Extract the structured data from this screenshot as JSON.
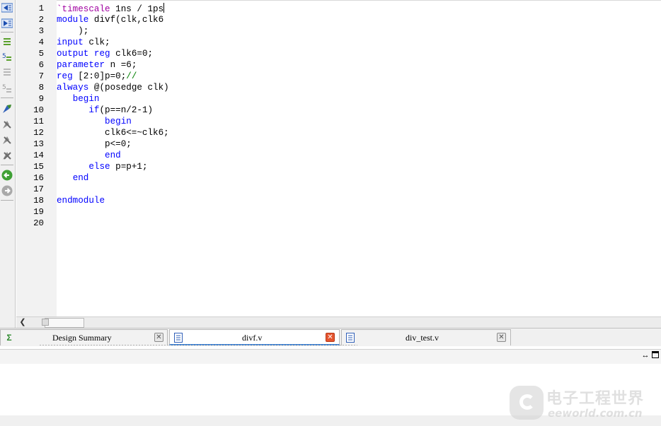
{
  "editor": {
    "line_numbers": [
      "1",
      "2",
      "3",
      "4",
      "5",
      "6",
      "7",
      "8",
      "9",
      "10",
      "11",
      "12",
      "13",
      "14",
      "15",
      "16",
      "17",
      "18",
      "19",
      "20"
    ],
    "lines": {
      "l1": {
        "directive": "`timescale",
        "rest": " 1ns / 1ps"
      },
      "l2": {
        "kw": "module",
        "rest": " divf(clk,clk6"
      },
      "l3": {
        "text": "    );"
      },
      "l4": {
        "kw": "input",
        "rest": " clk;"
      },
      "l5": {
        "kw1": "output",
        "sp": " ",
        "kw2": "reg",
        "rest": " clk6=0;"
      },
      "l6": {
        "kw": "parameter",
        "rest": " n =6;"
      },
      "l7": {
        "kw": "reg",
        "rest": " [2:0]p=0;",
        "comment": "//"
      },
      "l8": {
        "kw": "always",
        "rest": " @(posedge clk)"
      },
      "l9": {
        "indent": "   ",
        "kw": "begin"
      },
      "l10": {
        "indent": "      ",
        "kw": "if",
        "rest": "(p==n/2-1)"
      },
      "l11": {
        "indent": "         ",
        "kw": "begin"
      },
      "l12": {
        "text": "         clk6<=~clk6;"
      },
      "l13": {
        "text": "         p<=0;"
      },
      "l14": {
        "indent": "         ",
        "kw": "end"
      },
      "l15": {
        "indent": "      ",
        "kw": "else",
        "rest": " p=p+1;"
      },
      "l16": {
        "indent": "   ",
        "kw": "end"
      },
      "l17": {
        "text": ""
      },
      "l18": {
        "kw": "endmodule"
      }
    }
  },
  "tabs": [
    {
      "label": "Design Summary",
      "icon": "sigma-icon"
    },
    {
      "label": "divf.v",
      "icon": "file-icon"
    },
    {
      "label": "div_test.v",
      "icon": "file-icon"
    }
  ],
  "watermark": {
    "cn": "电子工程世界",
    "en": "eeworld.com.cn"
  },
  "colors": {
    "keyword": "#0000ff",
    "directive": "#a000a0",
    "comment": "#008000",
    "active_tab_underline": "#3c7fd0"
  }
}
